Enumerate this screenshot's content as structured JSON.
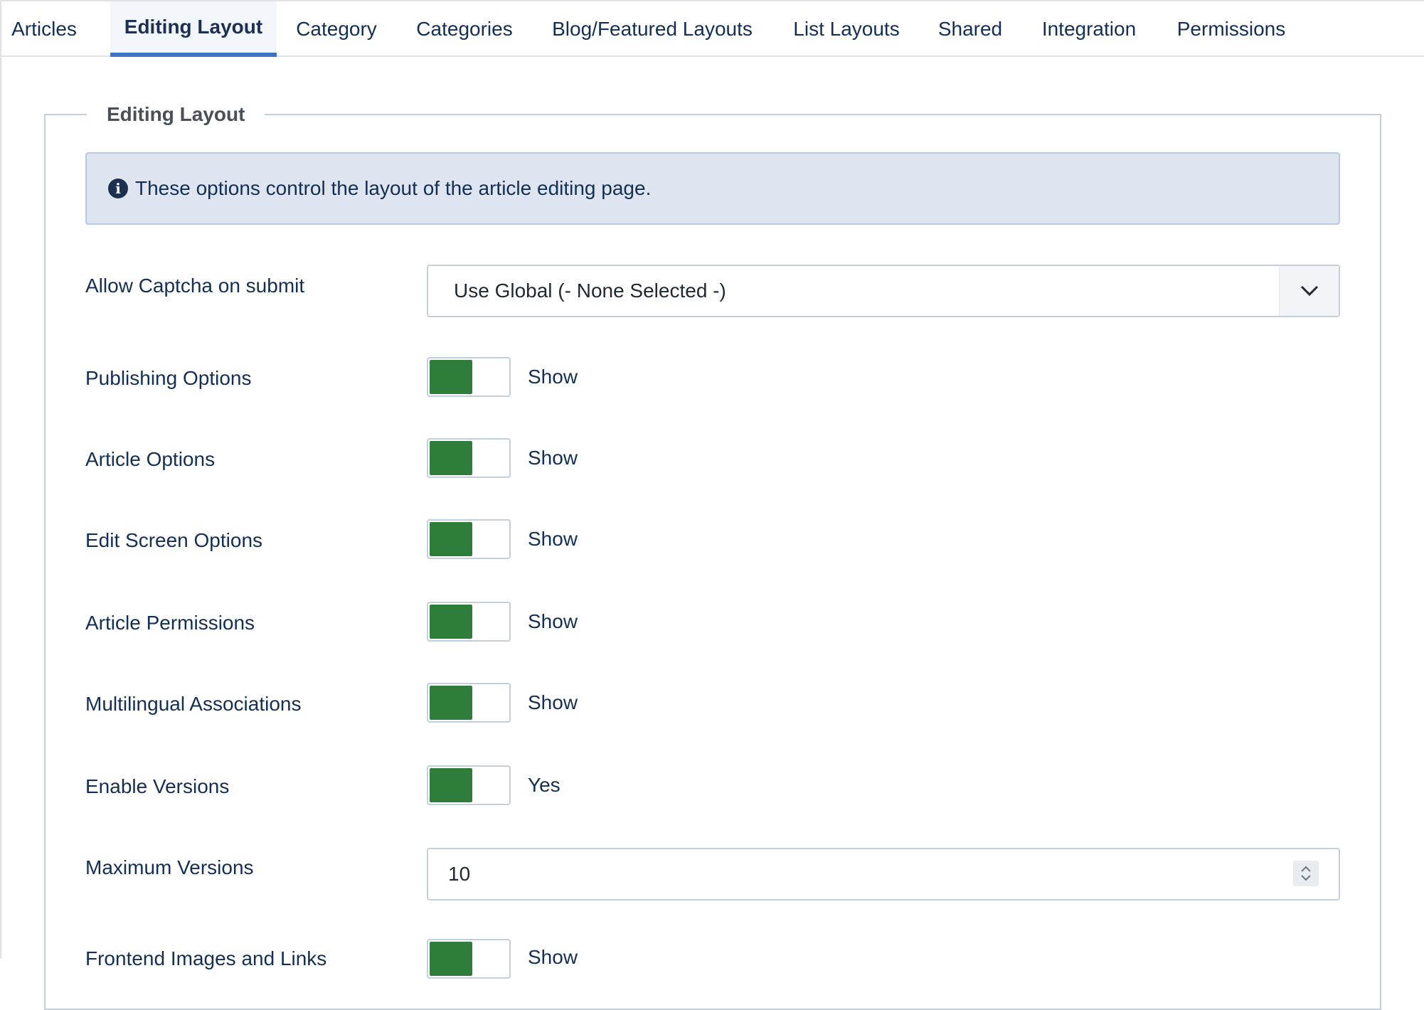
{
  "tabs": [
    {
      "label": "Articles"
    },
    {
      "label": "Editing Layout",
      "active": true
    },
    {
      "label": "Category"
    },
    {
      "label": "Categories"
    },
    {
      "label": "Blog/Featured Layouts"
    },
    {
      "label": "List Layouts"
    },
    {
      "label": "Shared"
    },
    {
      "label": "Integration"
    },
    {
      "label": "Permissions"
    }
  ],
  "fieldset": {
    "legend": "Editing Layout",
    "info": {
      "icon": "info-circle-icon",
      "text": "These options control the layout of the article editing page."
    }
  },
  "fields": {
    "captcha": {
      "label": "Allow Captcha on submit",
      "value": "Use Global (- None Selected -)"
    },
    "publishing_options": {
      "label": "Publishing Options",
      "state": "Show"
    },
    "article_options": {
      "label": "Article Options",
      "state": "Show"
    },
    "edit_screen_options": {
      "label": "Edit Screen Options",
      "state": "Show"
    },
    "article_permissions": {
      "label": "Article Permissions",
      "state": "Show"
    },
    "multilingual_associations": {
      "label": "Multilingual Associations",
      "state": "Show"
    },
    "enable_versions": {
      "label": "Enable Versions",
      "state": "Yes"
    },
    "maximum_versions": {
      "label": "Maximum Versions",
      "value": "10"
    },
    "frontend_images_links": {
      "label": "Frontend Images and Links",
      "state": "Show"
    }
  },
  "colors": {
    "toggle_on": "#2e7d3a",
    "tab_active_border": "#3f73c5",
    "info_bg": "#dee5f1"
  }
}
